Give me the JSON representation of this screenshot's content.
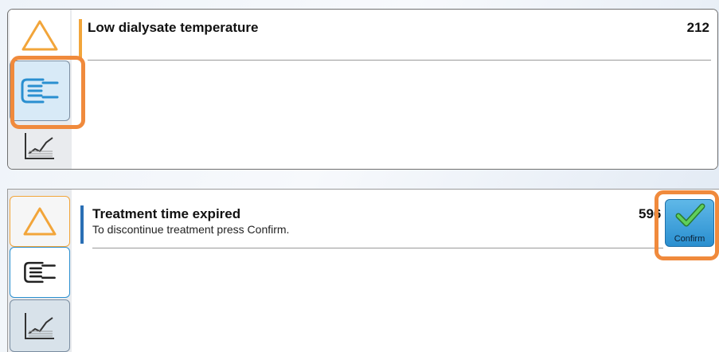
{
  "top_panel": {
    "alarm_title": "Low dialysate temperature",
    "alarm_code": "212",
    "tabs": [
      "warning-icon",
      "hand-icon",
      "trend-chart-icon"
    ]
  },
  "bottom_panel": {
    "alarm_title": "Treatment time expired",
    "alarm_message": "To discontinue treatment press Confirm.",
    "alarm_code": "596",
    "confirm_label": "Confirm",
    "tabs": [
      "warning-icon",
      "hand-icon",
      "trend-chart-icon"
    ]
  },
  "colors": {
    "highlight": "#f08a3c",
    "accent_blue": "#2a8fd0",
    "warning_orange": "#f2a53a",
    "check_green": "#3aa64a"
  }
}
